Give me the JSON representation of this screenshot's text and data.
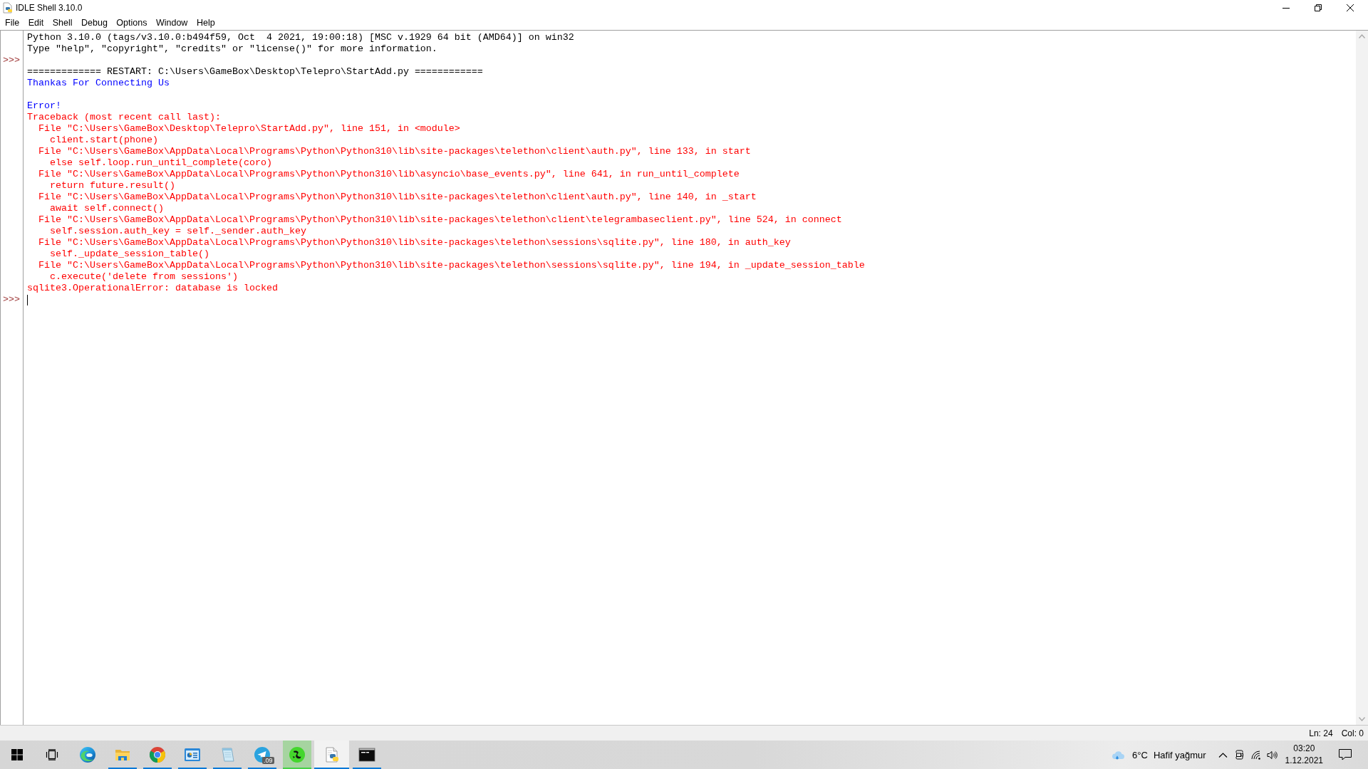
{
  "window": {
    "title": "IDLE Shell 3.10.0"
  },
  "menu": [
    "File",
    "Edit",
    "Shell",
    "Debug",
    "Options",
    "Window",
    "Help"
  ],
  "shell": {
    "lines": [
      {
        "kind": "console",
        "text": "Python 3.10.0 (tags/v3.10.0:b494f59, Oct  4 2021, 19:00:18) [MSC v.1929 64 bit (AMD64)] on win32",
        "cursor": false
      },
      {
        "kind": "console",
        "text": "Type \"help\", \"copyright\", \"credits\" or \"license()\" for more information.",
        "cursor": false
      },
      {
        "kind": "prompt",
        "prompt": ">>>",
        "cursor": false
      },
      {
        "kind": "console",
        "text": "============= RESTART: C:\\Users\\GameBox\\Desktop\\Telepro\\StartAdd.py ============",
        "cursor": false
      },
      {
        "kind": "stdout",
        "text": "Thankas For Connecting Us",
        "cursor": false
      },
      {
        "kind": "blank",
        "cursor": false
      },
      {
        "kind": "stdout",
        "text": "Error!",
        "cursor": false
      },
      {
        "kind": "stderr",
        "text": "Traceback (most recent call last):",
        "cursor": false
      },
      {
        "kind": "stderr",
        "text": "  File \"C:\\Users\\GameBox\\Desktop\\Telepro\\StartAdd.py\", line 151, in <module>",
        "cursor": false
      },
      {
        "kind": "stderr",
        "text": "    client.start(phone)",
        "cursor": false
      },
      {
        "kind": "stderr",
        "text": "  File \"C:\\Users\\GameBox\\AppData\\Local\\Programs\\Python\\Python310\\lib\\site-packages\\telethon\\client\\auth.py\", line 133, in start",
        "cursor": false
      },
      {
        "kind": "stderr",
        "text": "    else self.loop.run_until_complete(coro)",
        "cursor": false
      },
      {
        "kind": "stderr",
        "text": "  File \"C:\\Users\\GameBox\\AppData\\Local\\Programs\\Python\\Python310\\lib\\asyncio\\base_events.py\", line 641, in run_until_complete",
        "cursor": false
      },
      {
        "kind": "stderr",
        "text": "    return future.result()",
        "cursor": false
      },
      {
        "kind": "stderr",
        "text": "  File \"C:\\Users\\GameBox\\AppData\\Local\\Programs\\Python\\Python310\\lib\\site-packages\\telethon\\client\\auth.py\", line 140, in _start",
        "cursor": false
      },
      {
        "kind": "stderr",
        "text": "    await self.connect()",
        "cursor": false
      },
      {
        "kind": "stderr",
        "text": "  File \"C:\\Users\\GameBox\\AppData\\Local\\Programs\\Python\\Python310\\lib\\site-packages\\telethon\\client\\telegrambaseclient.py\", line 524, in connect",
        "cursor": false
      },
      {
        "kind": "stderr",
        "text": "    self.session.auth_key = self._sender.auth_key",
        "cursor": false
      },
      {
        "kind": "stderr",
        "text": "  File \"C:\\Users\\GameBox\\AppData\\Local\\Programs\\Python\\Python310\\lib\\site-packages\\telethon\\sessions\\sqlite.py\", line 180, in auth_key",
        "cursor": false
      },
      {
        "kind": "stderr",
        "text": "    self._update_session_table()",
        "cursor": false
      },
      {
        "kind": "stderr",
        "text": "  File \"C:\\Users\\GameBox\\AppData\\Local\\Programs\\Python\\Python310\\lib\\site-packages\\telethon\\sessions\\sqlite.py\", line 194, in _update_session_table",
        "cursor": false
      },
      {
        "kind": "stderr",
        "text": "    c.execute('delete from sessions')",
        "cursor": false
      },
      {
        "kind": "stderr",
        "text": "sqlite3.OperationalError: database is locked",
        "cursor": false
      },
      {
        "kind": "prompt",
        "prompt": ">>>",
        "cursor": true
      }
    ]
  },
  "status_bar": {
    "line": "Ln: 24",
    "column": "Col: 0"
  },
  "taskbar": {
    "apps": [
      {
        "kind": "wave",
        "running": false,
        "selected": false,
        "highlighted": false
      },
      {
        "kind": "folder",
        "running": true,
        "selected": false,
        "highlighted": false
      },
      {
        "kind": "ring",
        "running": true,
        "selected": false,
        "highlighted": false
      },
      {
        "kind": "panel",
        "running": true,
        "selected": false,
        "highlighted": false
      },
      {
        "kind": "notepad",
        "running": true,
        "selected": false,
        "highlighted": false
      },
      {
        "kind": "plane",
        "running": true,
        "selected": false,
        "highlighted": false,
        "badge": ".09"
      },
      {
        "kind": "snake",
        "running": true,
        "selected": false,
        "highlighted": true
      },
      {
        "kind": "document",
        "running": true,
        "selected": true,
        "highlighted": false
      },
      {
        "kind": "terminal",
        "running": true,
        "selected": false,
        "highlighted": false
      }
    ],
    "weather": {
      "temperature": "6°C",
      "condition": "Hafif yağmur"
    },
    "clock": {
      "time": "03:20",
      "date": "1.12.2021"
    }
  }
}
